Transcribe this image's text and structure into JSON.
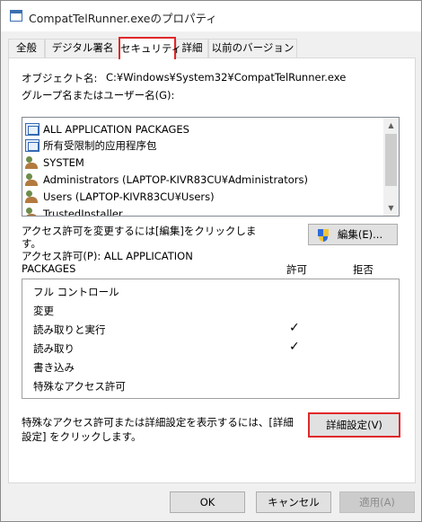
{
  "window": {
    "title": "CompatTelRunner.exeのプロパティ"
  },
  "tabs": [
    {
      "label": "全般"
    },
    {
      "label": "デジタル署名"
    },
    {
      "label": "セキュリティ"
    },
    {
      "label": "詳細"
    },
    {
      "label": "以前のバージョン"
    }
  ],
  "security": {
    "object_name_label": "オブジェクト名:",
    "object_name_value": "C:¥Windows¥System32¥CompatTelRunner.exe",
    "group_label": "グループ名またはユーザー名(G):",
    "principals": [
      {
        "name": "ALL APPLICATION PACKAGES",
        "icon": "package-icon"
      },
      {
        "name": "所有受限制的应用程序包",
        "icon": "package-icon"
      },
      {
        "name": "SYSTEM",
        "icon": "users-icon"
      },
      {
        "name": "Administrators (LAPTOP-KIVR83CU¥Administrators)",
        "icon": "users-icon"
      },
      {
        "name": "Users (LAPTOP-KIVR83CU¥Users)",
        "icon": "users-icon"
      },
      {
        "name": "TrustedInstaller",
        "icon": "users-icon"
      }
    ],
    "change_hint_line1": "アクセス許可を変更するには[編集]をクリックしま",
    "change_hint_line2": "す。",
    "edit_button": "編集(E)...",
    "perm_for_line1": "アクセス許可(P): ALL APPLICATION",
    "perm_for_line2": "PACKAGES",
    "allow_header": "許可",
    "deny_header": "拒否",
    "permissions": [
      {
        "name": "フル コントロール",
        "allow": "",
        "deny": ""
      },
      {
        "name": "変更",
        "allow": "",
        "deny": ""
      },
      {
        "name": "読み取りと実行",
        "allow": "✓",
        "deny": ""
      },
      {
        "name": "読み取り",
        "allow": "✓",
        "deny": ""
      },
      {
        "name": "書き込み",
        "allow": "",
        "deny": ""
      },
      {
        "name": "特殊なアクセス許可",
        "allow": "",
        "deny": ""
      }
    ],
    "advanced_hint_line1": "特殊なアクセス許可または詳細設定を表示するには、[詳細",
    "advanced_hint_line2": "設定] をクリックします。",
    "advanced_button": "詳細設定(V)"
  },
  "footer": {
    "ok": "OK",
    "cancel": "キャンセル",
    "apply": "適用(A)"
  },
  "colors": {
    "highlight_red": "#e0282a",
    "window_bg": "#f0f0f0"
  }
}
